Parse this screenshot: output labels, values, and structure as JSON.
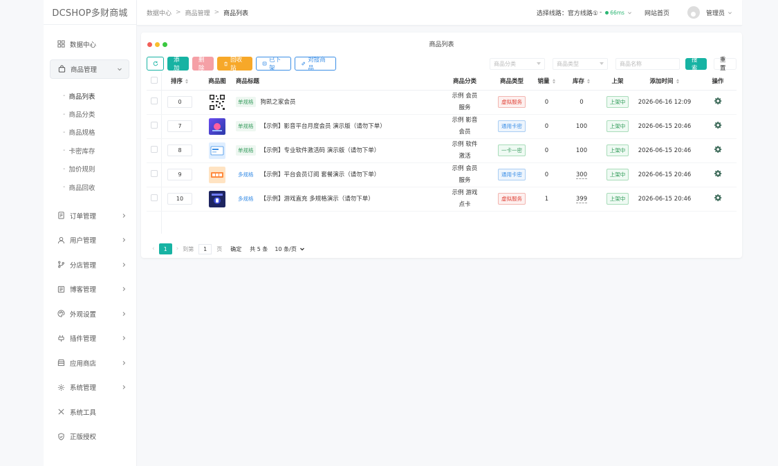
{
  "app": {
    "logo": "DCSHOP多财商城"
  },
  "header": {
    "breadcrumb": [
      "数据中心",
      "商品管理",
      "商品列表"
    ],
    "route_label": "选择线路：官方线路①",
    "ping": "66ms",
    "site_home": "网站首页",
    "user": "管理员"
  },
  "sidebar": {
    "items": [
      {
        "label": "数据中心",
        "icon": "dashboard-icon"
      },
      {
        "label": "商品管理",
        "icon": "bag-icon"
      },
      {
        "label": "订单管理",
        "icon": "order-icon"
      },
      {
        "label": "用户管理",
        "icon": "user-icon"
      },
      {
        "label": "分店管理",
        "icon": "branch-icon"
      },
      {
        "label": "博客管理",
        "icon": "blog-icon"
      },
      {
        "label": "外观设置",
        "icon": "palette-icon"
      },
      {
        "label": "插件管理",
        "icon": "plugin-icon"
      },
      {
        "label": "应用商店",
        "icon": "store-icon"
      },
      {
        "label": "系统管理",
        "icon": "gear-icon"
      },
      {
        "label": "系统工具",
        "icon": "tools-icon"
      },
      {
        "label": "正版授权",
        "icon": "shield-icon"
      }
    ],
    "submenu": [
      "商品列表",
      "商品分类",
      "商品规格",
      "卡密库存",
      "加价规则",
      "商品回收"
    ]
  },
  "panel": {
    "title": "商品列表"
  },
  "toolbar": {
    "add": "添加",
    "delete": "删除",
    "recycle": "回收站",
    "off_shelf": "已下架",
    "dock": "对接商品"
  },
  "filters": {
    "category_placeholder": "商品分类",
    "type_placeholder": "商品类型",
    "name_placeholder": "商品名称",
    "search": "搜索",
    "reset": "重置"
  },
  "table": {
    "headers": [
      "排序",
      "商品图",
      "商品标题",
      "商品分类",
      "商品类型",
      "销量",
      "库存",
      "上架",
      "添加时间",
      "操作"
    ],
    "rows": [
      {
        "sort": "0",
        "spec": "单规格",
        "title": "狗凯之家会员",
        "category": "示例 会员服务",
        "type": "虚拟服务",
        "type_kind": "virtual",
        "sales": "0",
        "stock": "0",
        "stock_ul": false,
        "status": "上架中",
        "time": "2026-06-16 12:09",
        "thumb": "qr"
      },
      {
        "sort": "7",
        "spec": "单规格",
        "title": "【示例】影音平台月度会员 演示版（请勿下单）",
        "category": "示例 影音会员",
        "type": "通用卡密",
        "type_kind": "card",
        "sales": "0",
        "stock": "100",
        "stock_ul": false,
        "status": "上架中",
        "time": "2026-06-15 20:46",
        "thumb": "blue"
      },
      {
        "sort": "8",
        "spec": "单规格",
        "title": "【示例】专业软件激活码 演示版（请勿下单）",
        "category": "示例 软件激活",
        "type": "一卡一密",
        "type_kind": "one",
        "sales": "0",
        "stock": "100",
        "stock_ul": false,
        "status": "上架中",
        "time": "2026-06-15 20:46",
        "thumb": "light"
      },
      {
        "sort": "9",
        "spec": "多规格",
        "title": "【示例】平台会员订阅 套餐演示（请勿下单）",
        "category": "示例 会员服务",
        "type": "通用卡密",
        "type_kind": "card",
        "sales": "0",
        "stock": "300",
        "stock_ul": true,
        "status": "上架中",
        "time": "2026-06-15 20:46",
        "thumb": "orange"
      },
      {
        "sort": "10",
        "spec": "多规格",
        "title": "【示例】游戏直充 多规格演示（请勿下单）",
        "category": "示例 游戏点卡",
        "type": "虚拟服务",
        "type_kind": "virtual",
        "sales": "1",
        "stock": "399",
        "stock_ul": true,
        "status": "上架中",
        "time": "2026-06-15 20:46",
        "thumb": "dark"
      }
    ]
  },
  "pager": {
    "current": "1",
    "goto_prefix": "到第",
    "goto_value": "1",
    "goto_suffix": "页",
    "confirm": "确定",
    "total": "共 5 条",
    "page_size": "10 条/页"
  },
  "colors": {
    "primary": "#17b3a3",
    "danger": "#f5a0a6",
    "warning": "#f7a829",
    "info": "#3a8ee6"
  }
}
